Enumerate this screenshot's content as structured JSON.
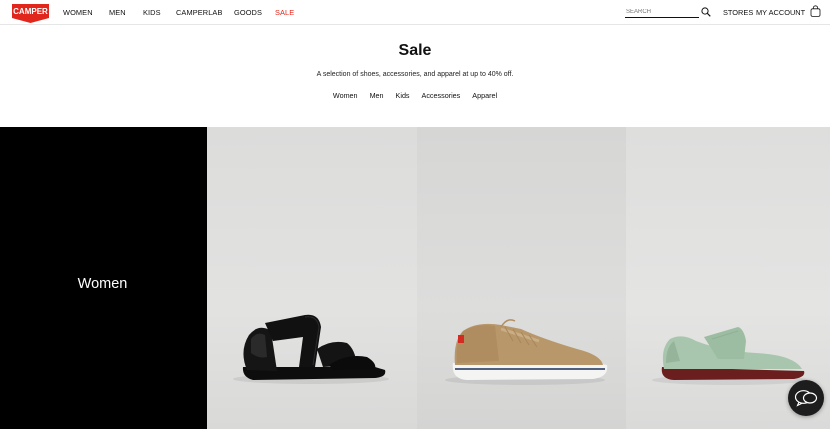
{
  "header": {
    "logo_text": "CAMPER",
    "nav": [
      {
        "label": "WOMEN"
      },
      {
        "label": "MEN"
      },
      {
        "label": "KIDS"
      },
      {
        "label": "CAMPERLAB"
      },
      {
        "label": "GOODS"
      },
      {
        "label": "SALE",
        "accent": "#e1261c"
      }
    ],
    "search_placeholder": "SEARCH",
    "stores_label": "STORES",
    "account_label": "MY ACCOUNT"
  },
  "hero": {
    "title": "Sale",
    "subtitle": "A selection of shoes, accessories, and apparel at up to 40% off.",
    "categories": [
      "Women",
      "Men",
      "Kids",
      "Accessories",
      "Apparel"
    ]
  },
  "strip": {
    "panel_label": "Women",
    "products": [
      {
        "image": "black-strappy-sandal"
      },
      {
        "image": "tan-lace-up-sneaker"
      },
      {
        "image": "mint-mary-jane-flat"
      }
    ]
  },
  "colors": {
    "brand_red": "#e1261c",
    "sale_red": "#e1261c",
    "panel_black": "#000000"
  },
  "icons": [
    "search-icon",
    "bag-icon",
    "chat-icon"
  ]
}
